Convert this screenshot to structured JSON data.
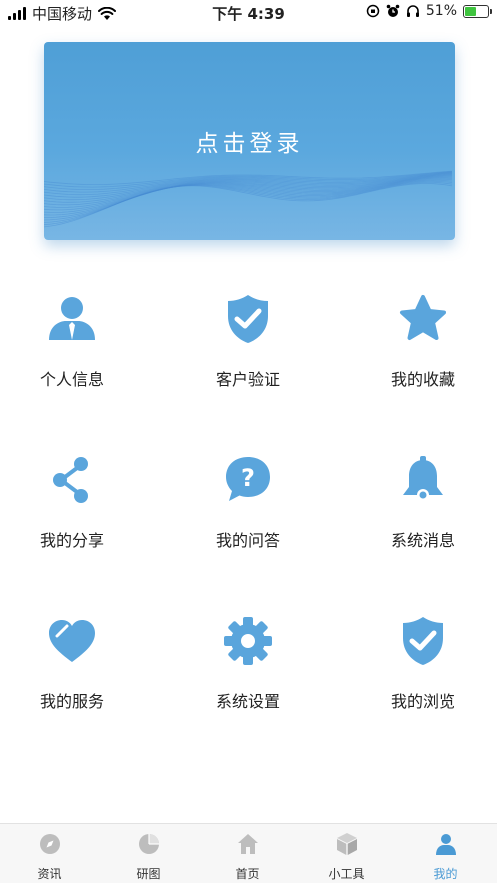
{
  "status_bar": {
    "carrier": "中国移动",
    "time": "下午 4:39",
    "battery_percent": "51%",
    "battery_level": 0.51
  },
  "login_banner": {
    "label": "点击登录"
  },
  "menu": [
    {
      "label": "个人信息",
      "icon": "person-icon"
    },
    {
      "label": "客户验证",
      "icon": "shield-check-icon"
    },
    {
      "label": "我的收藏",
      "icon": "star-icon"
    },
    {
      "label": "我的分享",
      "icon": "share-icon"
    },
    {
      "label": "我的问答",
      "icon": "question-bubble-icon"
    },
    {
      "label": "系统消息",
      "icon": "bell-icon"
    },
    {
      "label": "我的服务",
      "icon": "heart-icon"
    },
    {
      "label": "系统设置",
      "icon": "gear-icon"
    },
    {
      "label": "我的浏览",
      "icon": "shield-check-icon"
    }
  ],
  "tabs": [
    {
      "label": "资讯",
      "icon": "compass-icon",
      "active": false
    },
    {
      "label": "研图",
      "icon": "pie-chart-icon",
      "active": false
    },
    {
      "label": "首页",
      "icon": "home-icon",
      "active": false
    },
    {
      "label": "小工具",
      "icon": "cube-icon",
      "active": false
    },
    {
      "label": "我的",
      "icon": "person-icon",
      "active": true
    }
  ],
  "colors": {
    "accent": "#5aa5dc",
    "tab_inactive": "#bdbdbd",
    "tab_active": "#4a9ad4"
  }
}
